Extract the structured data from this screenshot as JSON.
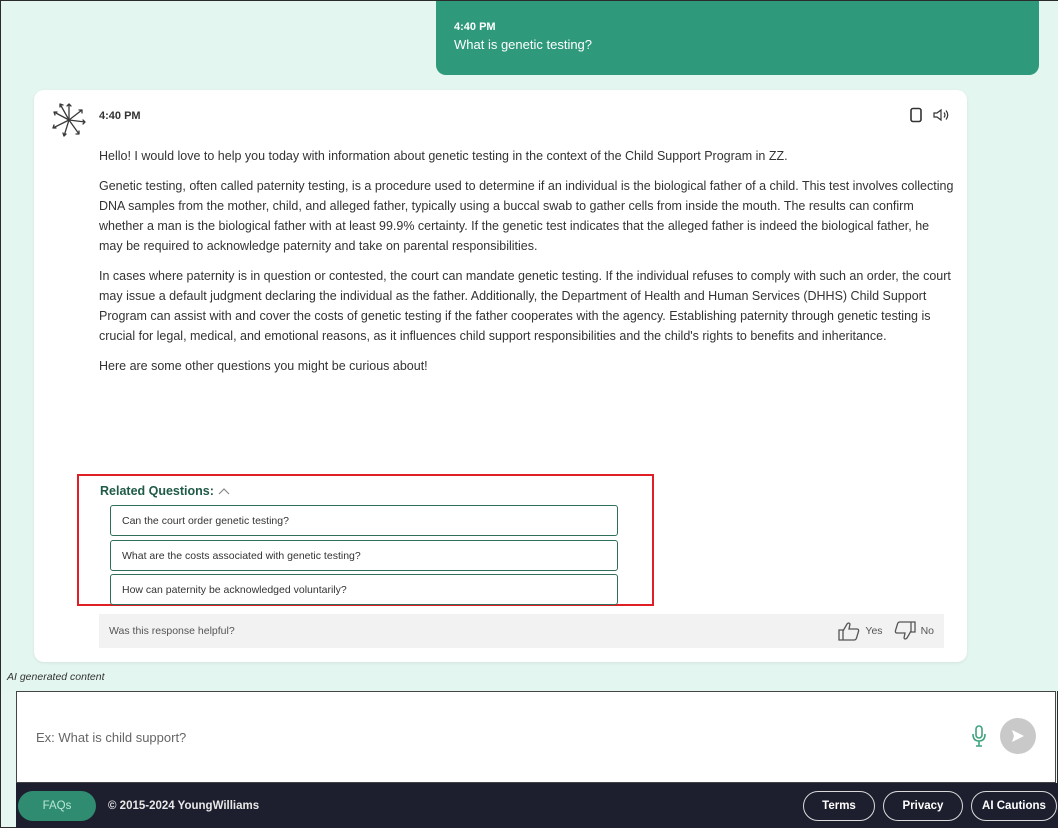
{
  "user_message": {
    "time": "4:40 PM",
    "text": "What is genetic testing?"
  },
  "bot_message": {
    "time": "4:40 PM",
    "paragraphs": [
      "Hello! I would love to help you today with information about genetic testing in the context of the Child Support Program in ZZ.",
      "Genetic testing, often called paternity testing, is a procedure used to determine if an individual is the biological father of a child. This test involves collecting DNA samples from the mother, child, and alleged father, typically using a buccal swab to gather cells from inside the mouth. The results can confirm whether a man is the biological father with at least 99.9% certainty. If the genetic test indicates that the alleged father is indeed the biological father, he may be required to acknowledge paternity and take on parental responsibilities.",
      "In cases where paternity is in question or contested, the court can mandate genetic testing. If the individual refuses to comply with such an order, the court may issue a default judgment declaring the individual as the father. Additionally, the Department of Health and Human Services (DHHS) Child Support Program can assist with and cover the costs of genetic testing if the father cooperates with the agency. Establishing paternity through genetic testing is crucial for legal, medical, and emotional reasons, as it influences child support responsibilities and the child's rights to benefits and inheritance.",
      "Here are some other questions you might be curious about!"
    ],
    "related": {
      "title": "Related Questions:",
      "questions": [
        "Can the court order genetic testing?",
        "What are the costs associated with genetic testing?",
        "How can paternity be acknowledged voluntarily?"
      ]
    },
    "feedback": {
      "prompt": "Was this response helpful?",
      "yes_label": "Yes",
      "no_label": "No"
    }
  },
  "ai_note": "AI generated content",
  "input": {
    "placeholder": "Ex: What is child support?"
  },
  "footer": {
    "faq_label": "FAQs",
    "copyright": "© 2015-2024 YoungWilliams",
    "terms_label": "Terms",
    "privacy_label": "Privacy",
    "cautions_label": "AI Cautions"
  },
  "colors": {
    "accent": "#2f9a7b",
    "background": "#e3f6ef",
    "footer": "#1e1f2e",
    "highlight": "#e01e25"
  }
}
